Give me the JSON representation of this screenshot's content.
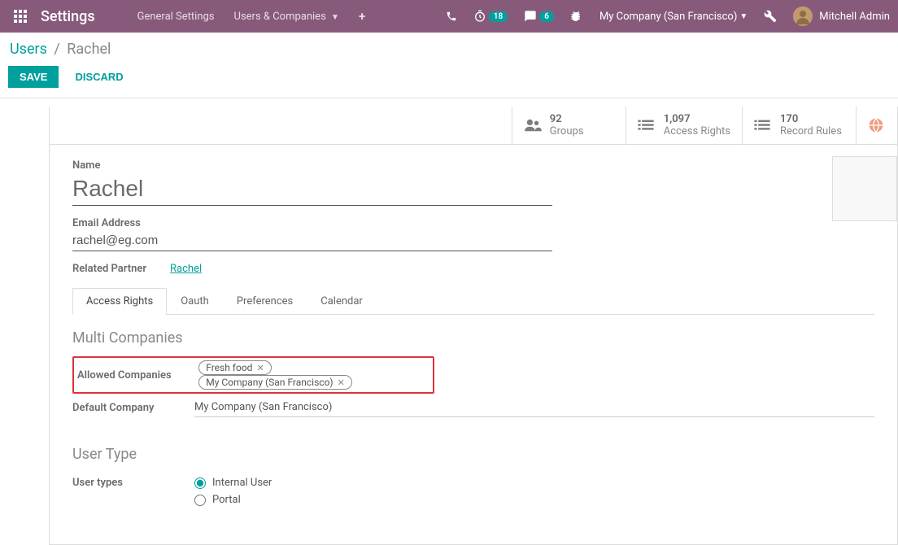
{
  "navbar": {
    "brand": "Settings",
    "menu": [
      {
        "label": "General Settings"
      },
      {
        "label": "Users & Companies"
      }
    ],
    "timer_badge": "18",
    "chat_badge": "6",
    "company": "My Company (San Francisco)",
    "user_name": "Mitchell Admin"
  },
  "breadcrumb": {
    "root": "Users",
    "sep": "/",
    "current": "Rachel"
  },
  "actions": {
    "save": "SAVE",
    "discard": "DISCARD"
  },
  "stats": {
    "groups": {
      "num": "92",
      "label": "Groups"
    },
    "access_rights": {
      "num": "1,097",
      "label": "Access Rights"
    },
    "record_rules": {
      "num": "170",
      "label": "Record Rules"
    }
  },
  "form": {
    "name_label": "Name",
    "name_value": "Rachel",
    "email_label": "Email Address",
    "email_value": "rachel@eg.com",
    "partner_label": "Related Partner",
    "partner_value": "Rachel"
  },
  "tabs": [
    "Access Rights",
    "Oauth",
    "Preferences",
    "Calendar"
  ],
  "multi_companies": {
    "title": "Multi Companies",
    "allowed_label": "Allowed Companies",
    "allowed_tags": [
      "Fresh food",
      "My Company (San Francisco)"
    ],
    "default_label": "Default Company",
    "default_value": "My Company (San Francisco)"
  },
  "user_type": {
    "title": "User Type",
    "label": "User types",
    "options": [
      {
        "label": "Internal User",
        "checked": true
      },
      {
        "label": "Portal",
        "checked": false
      }
    ]
  }
}
